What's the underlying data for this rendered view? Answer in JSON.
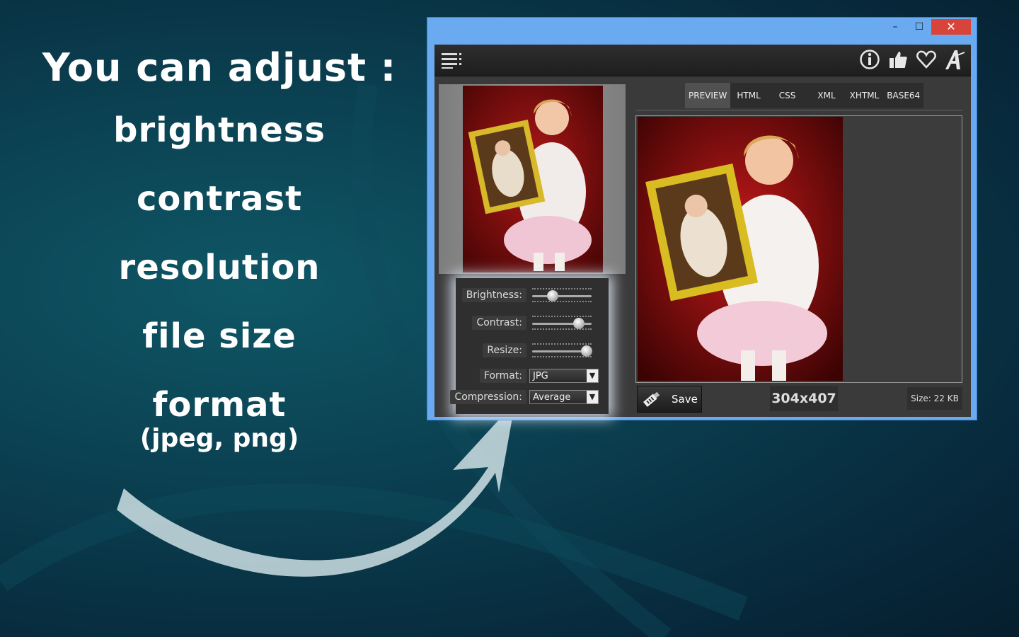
{
  "promo": {
    "heading": "You can adjust :",
    "items": [
      "brightness",
      "contrast",
      "resolution",
      "file size",
      "format"
    ],
    "format_note": "(jpeg, png)"
  },
  "window": {
    "controls": {
      "minimize": "–",
      "maximize": "☐",
      "close": "✕"
    },
    "toolbar_icons": [
      "menu-icon",
      "info-icon",
      "thumbs-up-icon",
      "heart-icon",
      "font-icon"
    ]
  },
  "tabs": [
    {
      "label": "PREVIEW",
      "active": true
    },
    {
      "label": "HTML",
      "active": false
    },
    {
      "label": "CSS",
      "active": false
    },
    {
      "label": "XML",
      "active": false
    },
    {
      "label": "XHTML",
      "active": false
    },
    {
      "label": "BASE64",
      "active": false
    }
  ],
  "adjustments": {
    "brightness": {
      "label": "Brightness:",
      "value": 0.35
    },
    "contrast": {
      "label": "Contrast:",
      "value": 0.78
    },
    "resize": {
      "label": "Resize:",
      "value": 0.92
    },
    "format": {
      "label": "Format:",
      "value": "JPG"
    },
    "compression": {
      "label": "Compression:",
      "value": "Average"
    }
  },
  "footer": {
    "save_label": "Save",
    "dimensions": "304x407",
    "size_text": "Size: 22 KB"
  },
  "colors": {
    "title_bar": "#6aaaf0",
    "close_button": "#d9443a",
    "panel_bg": "#3a3a3a"
  }
}
